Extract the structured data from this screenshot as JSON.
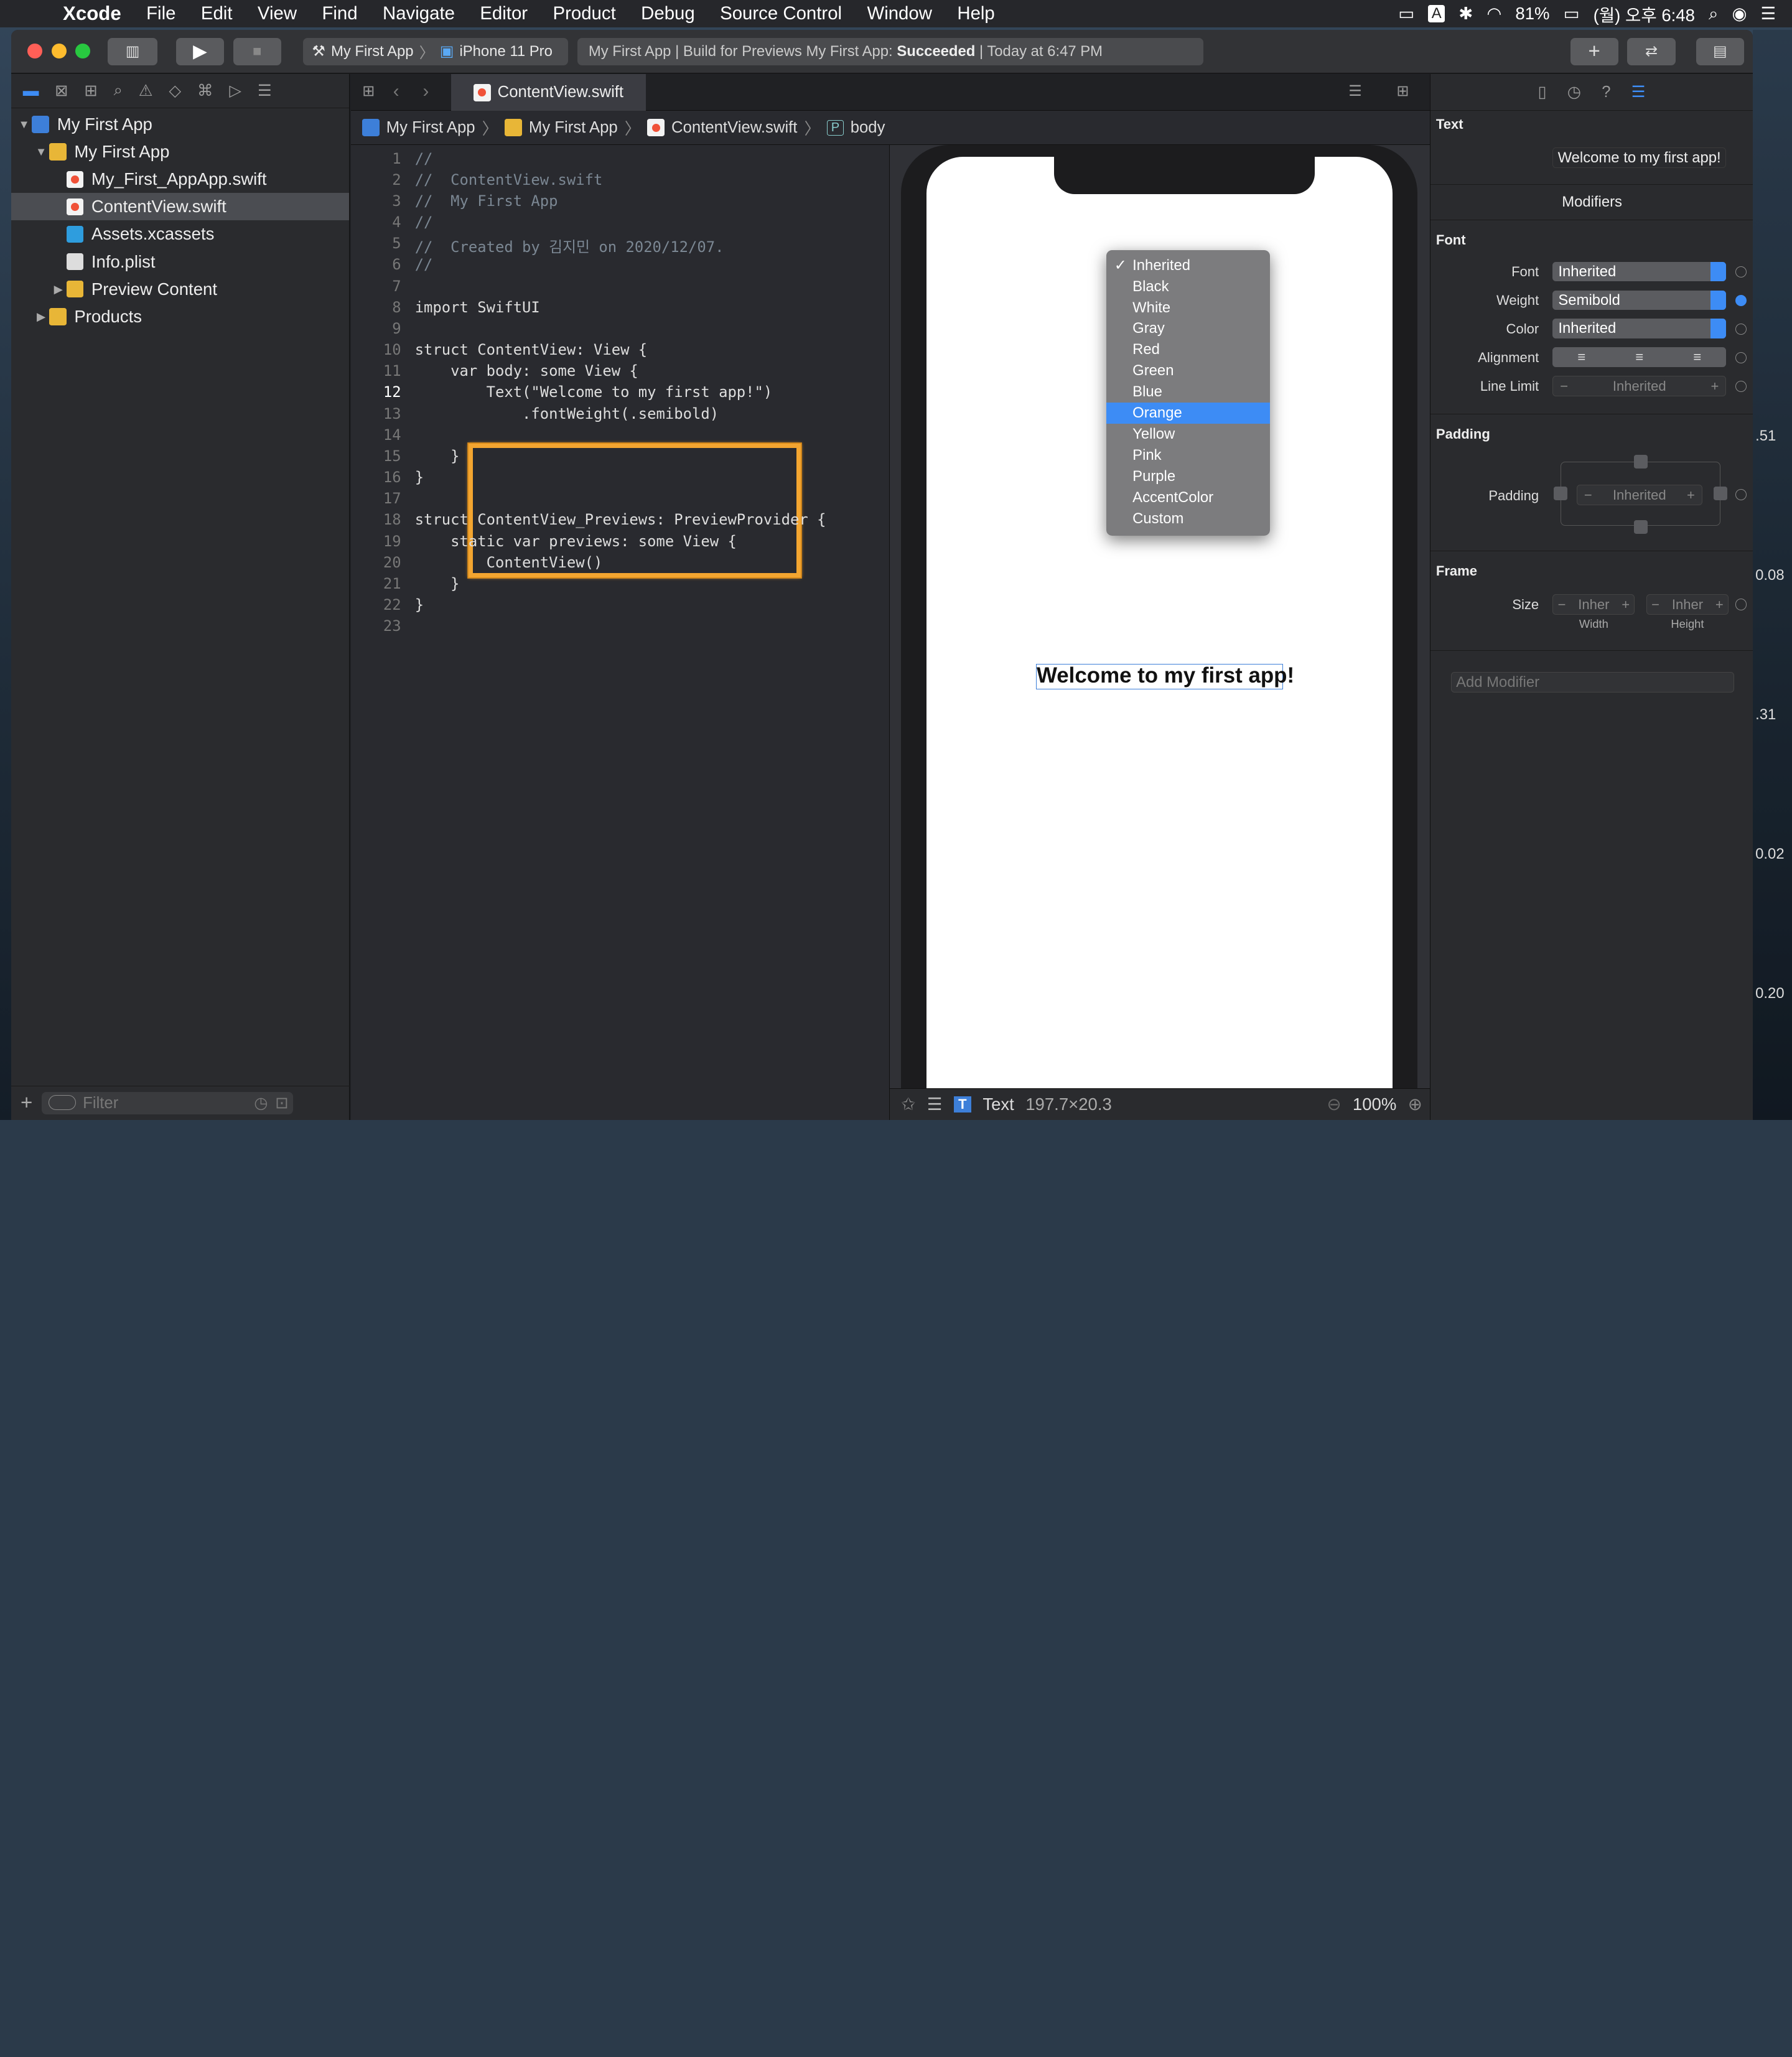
{
  "menubar": {
    "app": "Xcode",
    "items": [
      "File",
      "Edit",
      "View",
      "Find",
      "Navigate",
      "Editor",
      "Product",
      "Debug",
      "Source Control",
      "Window",
      "Help"
    ],
    "battery": "81%",
    "datetime": "(월) 오후 6:48",
    "input": "A"
  },
  "toolbar": {
    "scheme": "My First App",
    "device": "iPhone 11 Pro",
    "status_prefix": "My First App | Build for Previews My First App:",
    "status_result": "Succeeded",
    "status_time": "| Today at 6:47 PM"
  },
  "navigator": {
    "filter_placeholder": "Filter",
    "items": [
      {
        "label": "My First App",
        "type": "project",
        "level": 0,
        "open": true
      },
      {
        "label": "My First App",
        "type": "folder",
        "level": 1,
        "open": true
      },
      {
        "label": "My_First_AppApp.swift",
        "type": "swift",
        "level": 2
      },
      {
        "label": "ContentView.swift",
        "type": "swift",
        "level": 2,
        "selected": true
      },
      {
        "label": "Assets.xcassets",
        "type": "assets",
        "level": 2
      },
      {
        "label": "Info.plist",
        "type": "plist",
        "level": 2
      },
      {
        "label": "Preview Content",
        "type": "folder",
        "level": 2,
        "open": false
      },
      {
        "label": "Products",
        "type": "folder",
        "level": 1,
        "open": false
      }
    ]
  },
  "editor": {
    "tab": "ContentView.swift",
    "breadcrumb": [
      "My First App",
      "My First App",
      "ContentView.swift",
      "body"
    ]
  },
  "code": {
    "current_line": 12,
    "lines": [
      "//",
      "//  ContentView.swift",
      "//  My First App",
      "//",
      "//  Created by 김지민 on 2020/12/07.",
      "//",
      "",
      "import SwiftUI",
      "",
      "struct ContentView: View {",
      "    var body: some View {",
      "        Text(\"Welcome to my first app!\")",
      "            .fontWeight(.semibold)",
      "",
      "    }",
      "}",
      "",
      "struct ContentView_Previews: PreviewProvider {",
      "    static var previews: some View {",
      "        ContentView()",
      "    }",
      "}",
      ""
    ]
  },
  "preview": {
    "text": "Welcome to my first app!",
    "element": "Text",
    "size": "197.7×20.3",
    "zoom": "100%"
  },
  "color_menu": {
    "selected": "Orange",
    "checked": "Inherited",
    "options": [
      "Inherited",
      "Black",
      "White",
      "Gray",
      "Red",
      "Green",
      "Blue",
      "Orange",
      "Yellow",
      "Pink",
      "Purple",
      "AccentColor",
      "Custom"
    ]
  },
  "inspector": {
    "text_heading": "Text",
    "text_value": "Welcome to my first app!",
    "modifiers_heading": "Modifiers",
    "font_heading": "Font",
    "font_label": "Font",
    "font_value": "Inherited",
    "weight_label": "Weight",
    "weight_value": "Semibold",
    "color_label": "Color",
    "color_value": "Inherited",
    "alignment_label": "Alignment",
    "line_limit_label": "Line Limit",
    "line_limit_value": "Inherited",
    "padding_heading": "Padding",
    "padding_label": "Padding",
    "padding_value": "Inherited",
    "frame_heading": "Frame",
    "size_label": "Size",
    "width_value": "Inher",
    "height_value": "Inher",
    "width_label": "Width",
    "height_label": "Height",
    "add_modifier_placeholder": "Add Modifier"
  },
  "side_numbers": [
    ".51",
    "0.08",
    ".31",
    "0.02",
    "0.20"
  ],
  "colors": {
    "accent": "#3d8cf5",
    "highlight": "#f3a530"
  }
}
